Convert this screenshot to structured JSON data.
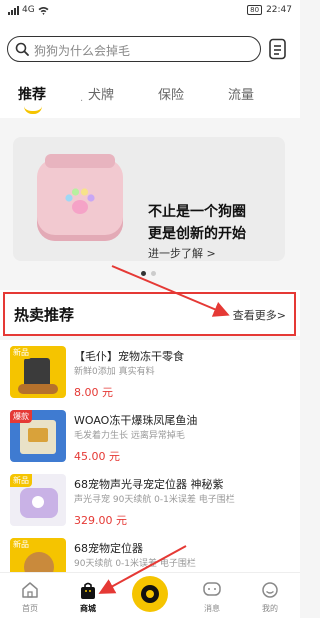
{
  "status_bar": {
    "network": "4G",
    "battery": "80",
    "time": "22:47"
  },
  "search": {
    "placeholder": "狗狗为什么会掉毛"
  },
  "tabs": [
    {
      "label": "推荐",
      "active": true
    },
    {
      "label": "犬牌",
      "active": false
    },
    {
      "label": "保险",
      "active": false
    },
    {
      "label": "流量",
      "active": false
    }
  ],
  "banner": {
    "line1": "不止是一个狗圈",
    "line2": "更是创新的开始",
    "more": "进一步了解 >",
    "page_count": 2,
    "current_page": 1
  },
  "hot": {
    "title": "热卖推荐",
    "more": "查看更多>"
  },
  "products": [
    {
      "tag": "新品",
      "name": "【毛仆】宠物冻干零食",
      "desc": "新鲜0添加 真实有料",
      "price": "8.00 元"
    },
    {
      "tag": "爆款",
      "name": "WOAO冻干爆珠凤尾鱼油",
      "desc": "毛发着力生长 远离异常掉毛",
      "price": "45.00 元"
    },
    {
      "tag": "新品",
      "name": "68宠物声光寻宠定位器 神秘紫",
      "desc": "声光寻宠 90天续航 0-1米误差 电子围栏",
      "price": "329.00 元"
    },
    {
      "tag": "新品",
      "name": "68宠物定位器",
      "desc": "90天续航 0-1米误差 电子围栏",
      "price": ""
    }
  ],
  "tabbar": [
    {
      "label": "首页",
      "icon": "home-icon",
      "active": false
    },
    {
      "label": "商城",
      "icon": "shop-bag-icon",
      "active": true
    },
    {
      "label": "",
      "icon": "center-ring-icon",
      "active": false
    },
    {
      "label": "消息",
      "icon": "message-icon",
      "active": false
    },
    {
      "label": "我的",
      "icon": "profile-icon",
      "active": false
    }
  ],
  "colors": {
    "accent": "#f5c400",
    "price": "#e53935",
    "annotation": "#e53935"
  }
}
